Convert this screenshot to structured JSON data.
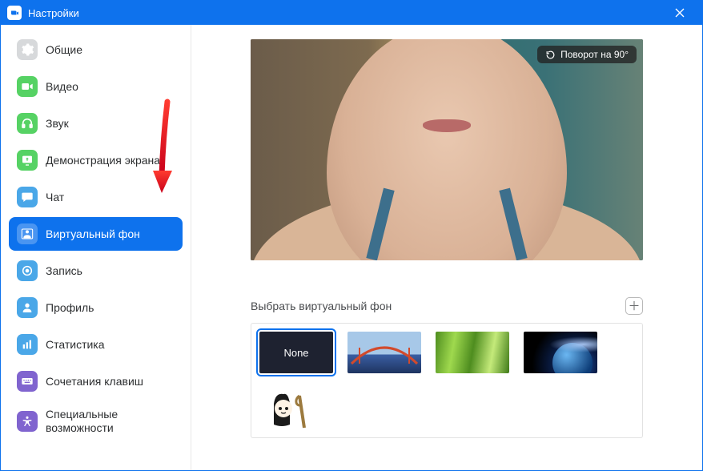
{
  "window": {
    "title": "Настройки"
  },
  "sidebar": {
    "items": [
      {
        "label": "Общие",
        "icon": "gear"
      },
      {
        "label": "Видео",
        "icon": "video"
      },
      {
        "label": "Звук",
        "icon": "headphones"
      },
      {
        "label": "Демонстрация экрана",
        "icon": "share"
      },
      {
        "label": "Чат",
        "icon": "chat"
      },
      {
        "label": "Виртуальный фон",
        "icon": "vbg",
        "active": true
      },
      {
        "label": "Запись",
        "icon": "record"
      },
      {
        "label": "Профиль",
        "icon": "profile"
      },
      {
        "label": "Статистика",
        "icon": "stats"
      },
      {
        "label": "Сочетания клавиш",
        "icon": "keyboard"
      },
      {
        "label": "Специальные возможности",
        "icon": "accessibility"
      }
    ]
  },
  "preview": {
    "rotate_label": "Поворот на 90°"
  },
  "vbg": {
    "section_title": "Выбрать виртуальный фон",
    "thumbs": [
      {
        "id": "none",
        "label": "None",
        "selected": true
      },
      {
        "id": "bridge"
      },
      {
        "id": "grass"
      },
      {
        "id": "earth"
      },
      {
        "id": "cartoon"
      }
    ]
  },
  "colors": {
    "gear": "#d7d9db",
    "video": "#56d264",
    "headphones": "#56d264",
    "share": "#56d264",
    "chat": "#4aa7e8",
    "vbg": "#ffffff",
    "record": "#4aa7e8",
    "profile": "#4aa7e8",
    "stats": "#4aa7e8",
    "keyboard": "#8064cf",
    "accessibility": "#8064cf"
  }
}
